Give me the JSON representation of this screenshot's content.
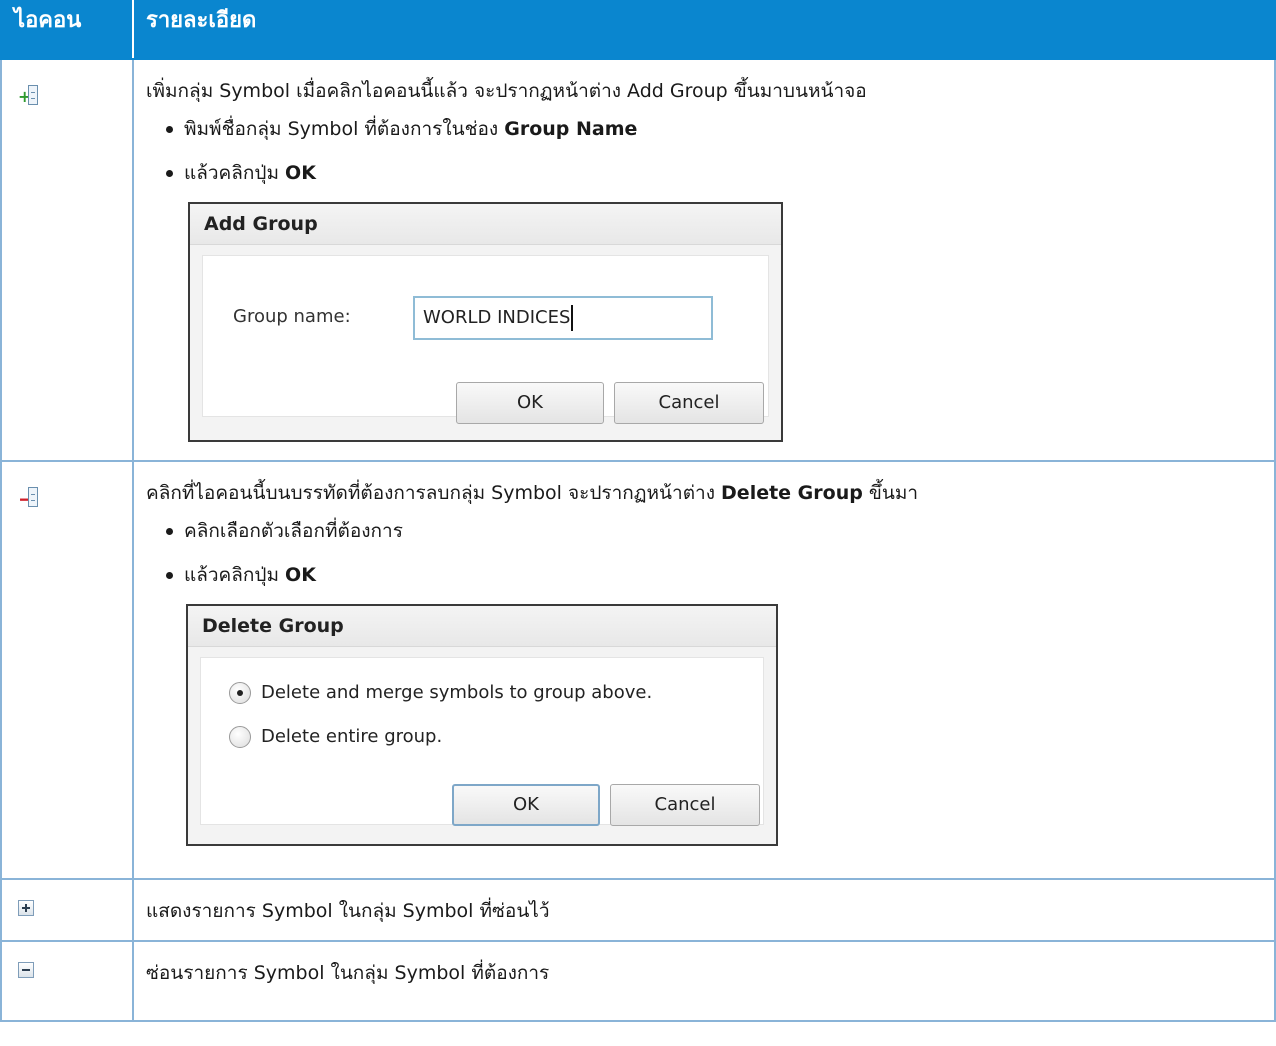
{
  "header": {
    "icon_col": "ไอคอน",
    "desc_col": "รายละเอียด"
  },
  "rows": [
    {
      "icon": "add-group-icon",
      "desc_pre": "เพิ่มกลุ่ม Symbol เมื่อคลิกไอคอนนี้แล้ว จะปรากฏหน้าต่าง Add Group ขึ้นมาบนหน้าจอ",
      "bullets": [
        {
          "text": "พิมพ์ชื่อกลุ่ม Symbol ที่ต้องการในช่อง ",
          "bold": "Group Name"
        },
        {
          "text": "แล้วคลิกปุ่ม ",
          "bold": "OK"
        }
      ],
      "dialog": {
        "title": "Add Group",
        "label": "Group name:",
        "input_value": "WORLD INDICES",
        "ok": "OK",
        "cancel": "Cancel"
      }
    },
    {
      "icon": "delete-group-icon",
      "desc_pre": "คลิกที่ไอคอนนี้บนบรรทัดที่ต้องการลบกลุ่ม Symbol จะปรากฏหน้าต่าง ",
      "desc_bold": "Delete Group",
      "desc_post": " ขึ้นมา",
      "bullets": [
        {
          "text": "คลิกเลือกตัวเลือกที่ต้องการ",
          "bold": ""
        },
        {
          "text": "แล้วคลิกปุ่ม ",
          "bold": "OK"
        }
      ],
      "dialog": {
        "title": "Delete Group",
        "option1": "Delete and merge symbols to group above.",
        "option2": "Delete entire group.",
        "ok": "OK",
        "cancel": "Cancel"
      }
    },
    {
      "icon": "expand-icon",
      "desc": "แสดงรายการ Symbol ในกลุ่ม Symbol ที่ซ่อนไว้"
    },
    {
      "icon": "collapse-icon",
      "desc": "ซ่อนรายการ Symbol ในกลุ่ม Symbol ที่ต้องการ"
    }
  ],
  "colors": {
    "header_bg": "#0a86cf",
    "border": "#8ab4d8",
    "add_sign": "#2e9a2e",
    "delete_sign": "#d0202a"
  }
}
